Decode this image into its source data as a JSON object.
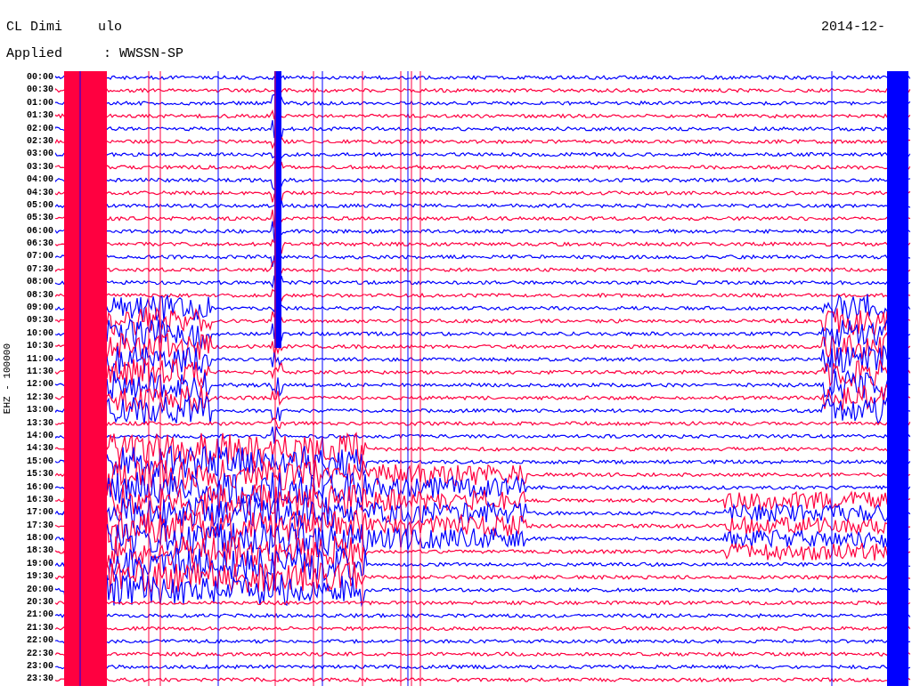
{
  "header": {
    "station_start": "CL Dimi",
    "station_end": "ulo",
    "date": "2014-12-",
    "filter_start": "Applied",
    "filter_end": ": WWSSN-SP"
  },
  "channel_label": "EHZ - 100000",
  "times": [
    "00:00",
    "00:30",
    "01:00",
    "01:30",
    "02:00",
    "02:30",
    "03:00",
    "03:30",
    "04:00",
    "04:30",
    "05:00",
    "05:30",
    "06:00",
    "06:30",
    "07:00",
    "07:30",
    "08:00",
    "08:30",
    "09:00",
    "09:30",
    "10:00",
    "10:30",
    "11:00",
    "11:30",
    "12:00",
    "12:30",
    "13:00",
    "13:30",
    "14:00",
    "14:30",
    "15:00",
    "15:30",
    "16:00",
    "16:30",
    "17:00",
    "17:30",
    "18:00",
    "18:30",
    "19:00",
    "19:30",
    "20:00",
    "20:30",
    "21:00",
    "21:30",
    "22:00",
    "22:30",
    "23:00",
    "23:30"
  ]
}
